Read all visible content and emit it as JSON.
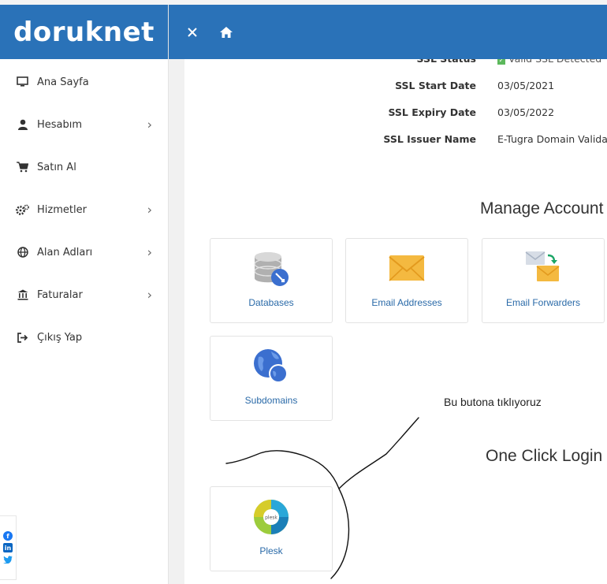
{
  "brand": {
    "logo_text": "doruknet",
    "primary_color": "#2a72b8"
  },
  "sidebar": {
    "items": [
      {
        "label": "Ana Sayfa",
        "icon": "monitor-icon",
        "has_submenu": false
      },
      {
        "label": "Hesabım",
        "icon": "user-icon",
        "has_submenu": true
      },
      {
        "label": "Satın Al",
        "icon": "cart-icon",
        "has_submenu": false
      },
      {
        "label": "Hizmetler",
        "icon": "gears-icon",
        "has_submenu": true
      },
      {
        "label": "Alan Adları",
        "icon": "globe-icon",
        "has_submenu": true
      },
      {
        "label": "Faturalar",
        "icon": "bank-icon",
        "has_submenu": true
      },
      {
        "label": "Çıkış Yap",
        "icon": "sign-out-icon",
        "has_submenu": false
      }
    ],
    "social": [
      "facebook-icon",
      "linkedin-icon",
      "twitter-icon"
    ]
  },
  "header": {
    "close_icon": "close-icon",
    "home_icon": "home-icon"
  },
  "ssl": {
    "status_label": "SSL Status",
    "status_value": "Valid SSL Detected",
    "start_label": "SSL Start Date",
    "start_value": "03/05/2021",
    "expiry_label": "SSL Expiry Date",
    "expiry_value": "03/05/2022",
    "issuer_label": "SSL Issuer Name",
    "issuer_value": "E-Tugra Domain Validat"
  },
  "manage": {
    "title": "Manage Account",
    "cards": [
      {
        "label": "Databases",
        "icon": "database-icon"
      },
      {
        "label": "Email Addresses",
        "icon": "envelope-icon"
      },
      {
        "label": "Email Forwarders",
        "icon": "email-forward-icon"
      },
      {
        "label": "Subdomains",
        "icon": "globe-subdomain-icon"
      }
    ]
  },
  "one_click": {
    "title": "One Click Login",
    "cards": [
      {
        "label": "Plesk",
        "icon": "plesk-icon"
      }
    ]
  },
  "annotation": {
    "text": "Bu butona tıklıyoruz"
  }
}
